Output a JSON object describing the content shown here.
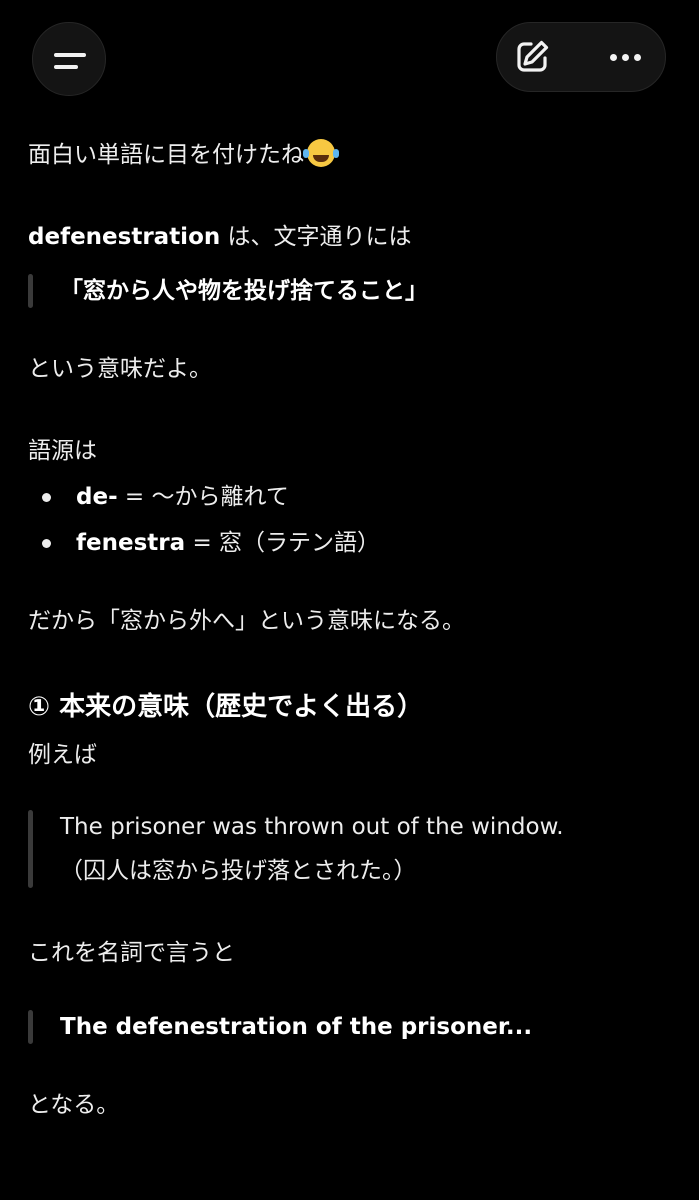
{
  "header": {
    "menu_icon": "menu-icon",
    "edit_icon": "new-chat-edit-icon",
    "more_icon": "more-options-icon"
  },
  "message": {
    "intro": "面白い単語に目を付けたね",
    "intro_emoji": "face-with-tears-of-joy-emoji",
    "def_word": "defenestration",
    "def_rest": " は、文字通りには",
    "def_quote": "「窓から人や物を投げ捨てること」",
    "def_meaning": "という意味だよ。",
    "etymology_label": "語源は",
    "etymology": [
      {
        "term": "de-",
        "rest": " = 〜から離れて"
      },
      {
        "term": "fenestra",
        "rest": " = 窓（ラテン語）"
      }
    ],
    "conclusion": "だから「窓から外へ」という意味になる。",
    "section1_heading": "① 本来の意味（歴史でよく出る）",
    "example_label": "例えば",
    "example_en": "The prisoner was thrown out of the window.",
    "example_ja": "（囚人は窓から投げ落とされた。）",
    "noun_label": "これを名詞で言うと",
    "noun_example": "The defenestration of the prisoner...",
    "becomes": "となる。"
  }
}
